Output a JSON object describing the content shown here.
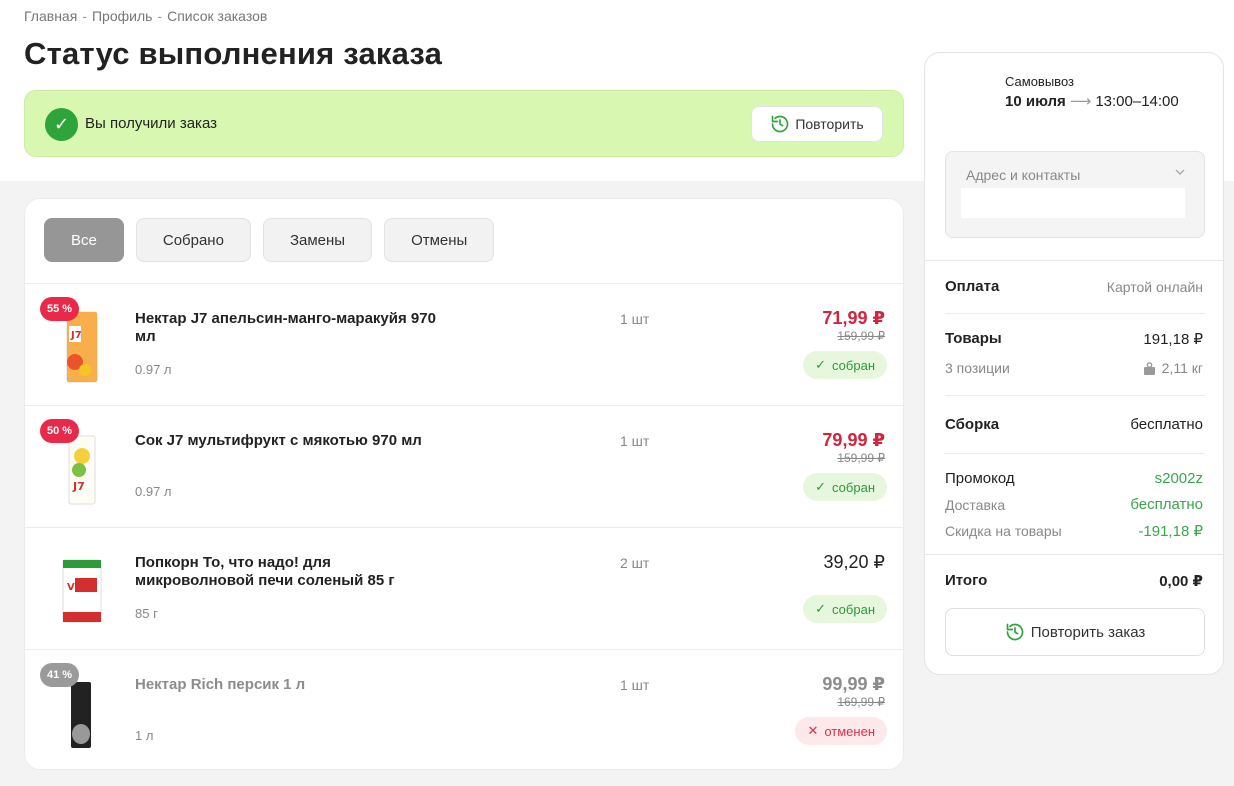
{
  "breadcrumb": [
    "Главная",
    "Профиль",
    "Список заказов"
  ],
  "page_title": "Статус выполнения заказа",
  "status": {
    "text": "Вы получили заказ",
    "repeat_label": "Повторить"
  },
  "filters": [
    "Все",
    "Собрано",
    "Замены",
    "Отмены"
  ],
  "items": [
    {
      "discount": "55 %",
      "name": "Нектар J7 апельсин-манго-маракуйя 970 мл",
      "volume": "0.97 л",
      "qty": "1 шт",
      "price": "71,99 ₽",
      "old_price": "159,99 ₽",
      "state": "собран"
    },
    {
      "discount": "50 %",
      "name": "Сок J7 мультифрукт с мякотью 970 мл",
      "volume": "0.97 л",
      "qty": "1 шт",
      "price": "79,99 ₽",
      "old_price": "159,99 ₽",
      "state": "собран"
    },
    {
      "name": "Попкорн То, что надо! для микроволновой печи соленый 85 г",
      "volume": "85 г",
      "qty": "2 шт",
      "price": "39,20 ₽",
      "state": "собран"
    },
    {
      "discount": "41 %",
      "name": "Нектар Rich персик 1 л",
      "volume": "1 л",
      "qty": "1 шт",
      "price": "99,99 ₽",
      "old_price": "169,99 ₽",
      "state": "отменен"
    }
  ],
  "sidebar": {
    "pickup_label": "Самовывоз",
    "pickup_date": "10 июля",
    "pickup_time": "13:00–14:00",
    "address_label": "Адрес и контакты",
    "payment_label": "Оплата",
    "payment_value": "Картой онлайн",
    "goods_label": "Товары",
    "goods_value": "191,18 ₽",
    "positions_label": "3 позиции",
    "weight_value": "2,11 кг",
    "assembly_label": "Сборка",
    "assembly_value": "бесплатно",
    "promo_label": "Промокод",
    "promo_value": "s2002z",
    "delivery_label": "Доставка",
    "delivery_value": "бесплатно",
    "discount_label": "Скидка на товары",
    "discount_value": "-191,18 ₽",
    "total_label": "Итого",
    "total_value": "0,00 ₽",
    "repeat_order_label": "Повторить заказ"
  },
  "colors": {
    "accent_green": "#2ea43a",
    "banner_bg": "#d8f7b0",
    "sale_red": "#e8294a"
  }
}
